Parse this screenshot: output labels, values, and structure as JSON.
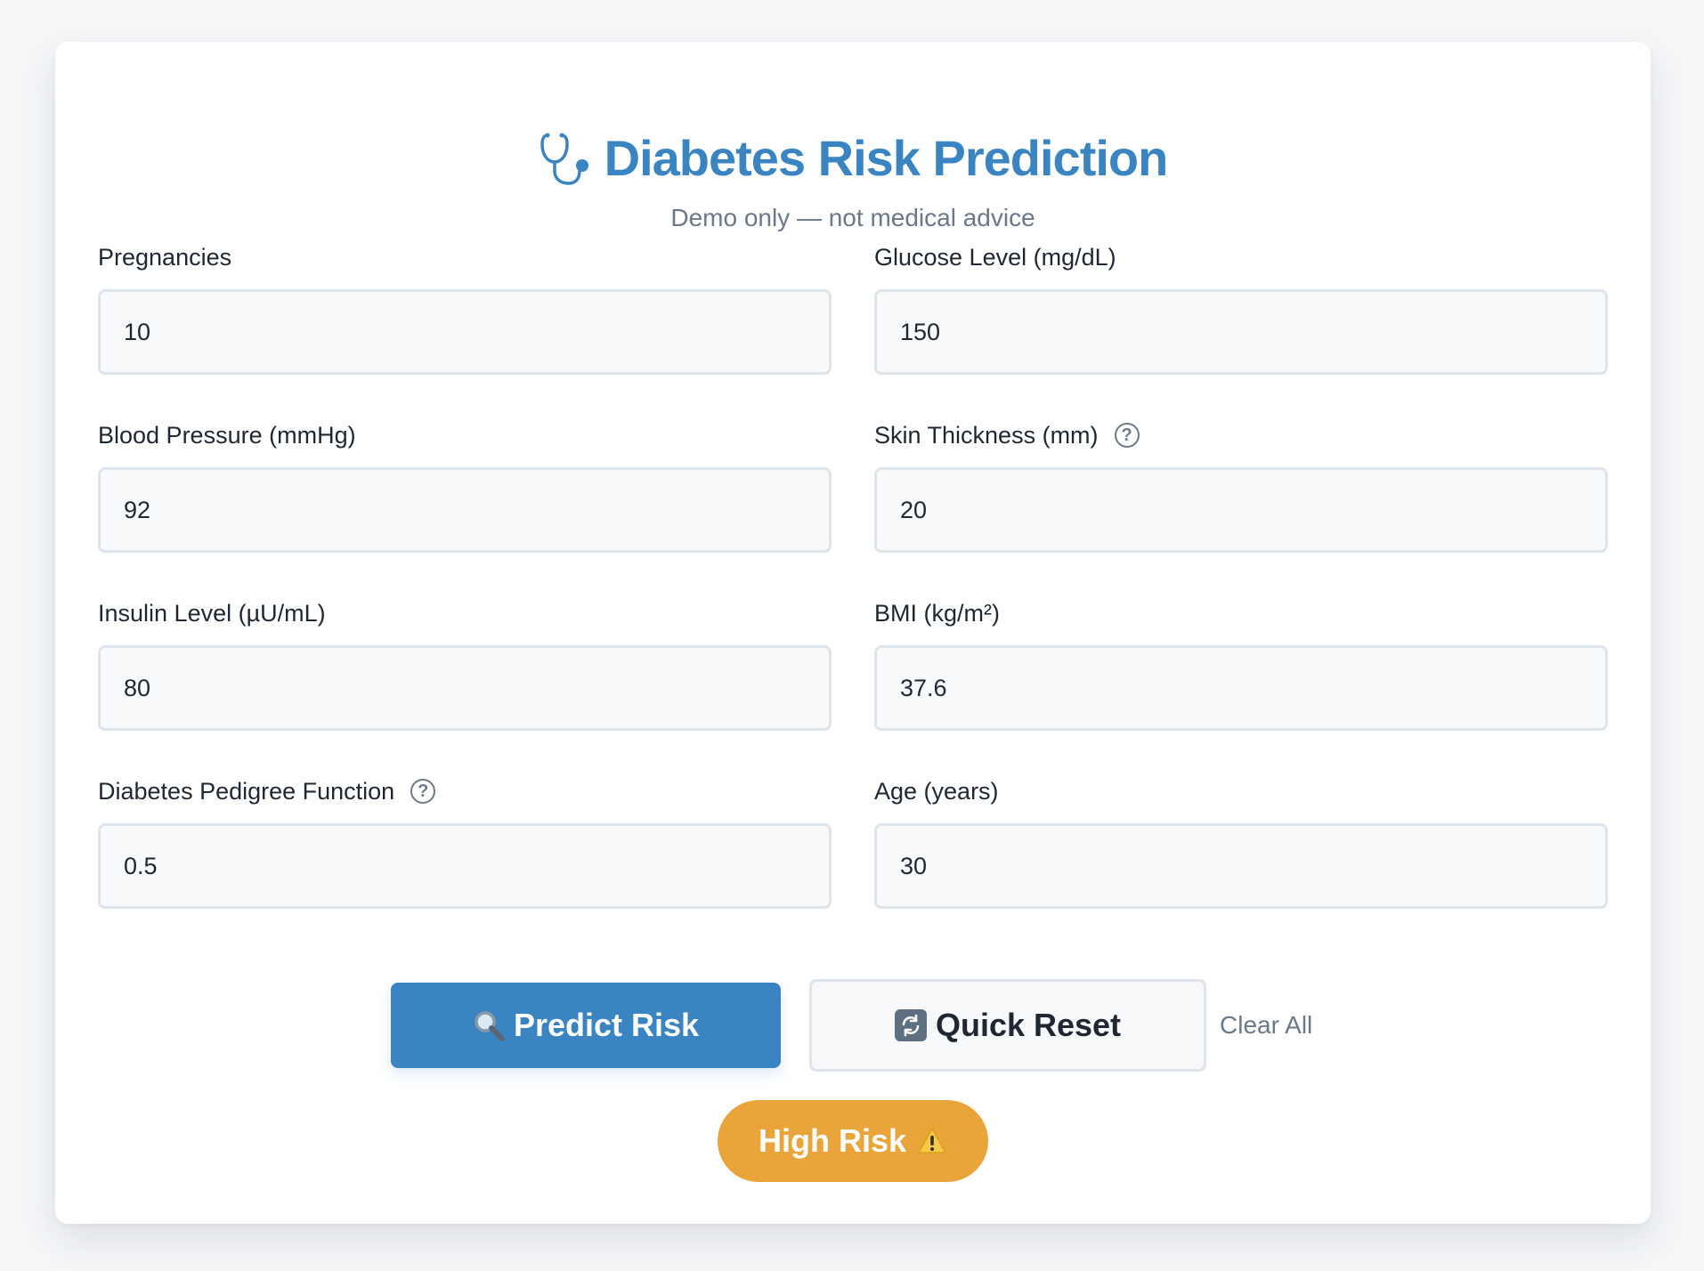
{
  "header": {
    "title": "Diabetes Risk Prediction",
    "icon": "stethoscope-icon",
    "subtitle": "Demo only — not medical advice",
    "title_color": "#3a84c2"
  },
  "form": {
    "fields": [
      {
        "id": "pregnancies",
        "label": "Pregnancies",
        "value": "10",
        "help": false
      },
      {
        "id": "glucose",
        "label": "Glucose Level (mg/dL)",
        "value": "150",
        "help": false
      },
      {
        "id": "blood_pressure",
        "label": "Blood Pressure (mmHg)",
        "value": "92",
        "help": false
      },
      {
        "id": "skin_thickness",
        "label": "Skin Thickness (mm)",
        "value": "20",
        "help": true
      },
      {
        "id": "insulin",
        "label": "Insulin Level (µU/mL)",
        "value": "80",
        "help": false
      },
      {
        "id": "bmi",
        "label": "BMI (kg/m²)",
        "value": "37.6",
        "help": false
      },
      {
        "id": "pedigree",
        "label": "Diabetes Pedigree Function",
        "value": "0.5",
        "help": true
      },
      {
        "id": "age",
        "label": "Age (years)",
        "value": "30",
        "help": false
      }
    ],
    "help_glyph": "?"
  },
  "actions": {
    "predict_label": "Predict Risk",
    "predict_icon": "magnifier-icon",
    "reset_label": "Quick Reset",
    "reset_icon": "refresh-icon",
    "clear_label": "Clear All",
    "primary_color": "#3a84c2"
  },
  "result": {
    "label": "High Risk",
    "icon": "warning-icon",
    "color": "#e9a43a"
  }
}
